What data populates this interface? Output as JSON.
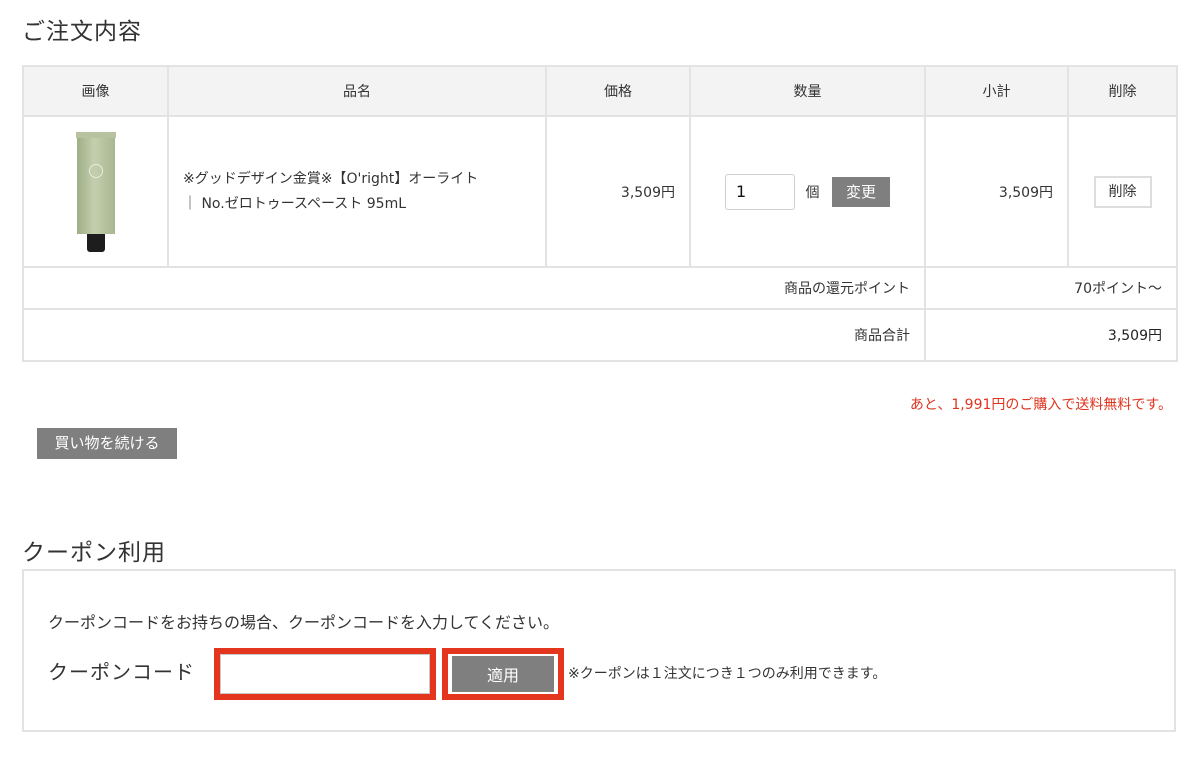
{
  "order": {
    "title": "ご注文内容",
    "headers": [
      "画像",
      "品名",
      "価格",
      "数量",
      "小計",
      "削除"
    ],
    "item": {
      "name_line1": "※グッドデザイン金賞※【O'right】オーライト",
      "name_line2": "｜ No.ゼロトゥースペースト 95mL",
      "price": "3,509円",
      "quantity": "1",
      "quantity_unit": "個",
      "change_label": "変更",
      "subtotal": "3,509円",
      "delete_label": "削除"
    },
    "points_label": "商品の還元ポイント",
    "points_value": "70ポイント〜",
    "total_label": "商品合計",
    "total_value": "3,509円"
  },
  "shipping_note": "あと、1,991円のご購入で送料無料です。",
  "continue_label": "買い物を続ける",
  "coupon": {
    "title": "クーポン利用",
    "description": "クーポンコードをお持ちの場合、クーポンコードを入力してください。",
    "code_label": "クーポンコード",
    "code_value": "",
    "apply_label": "適用",
    "note": "※クーポンは１注文につき１つのみ利用できます。"
  },
  "colors": {
    "highlight": "#e4361f",
    "button_gray": "#7f7f7f",
    "notice_red": "#e0341f"
  }
}
